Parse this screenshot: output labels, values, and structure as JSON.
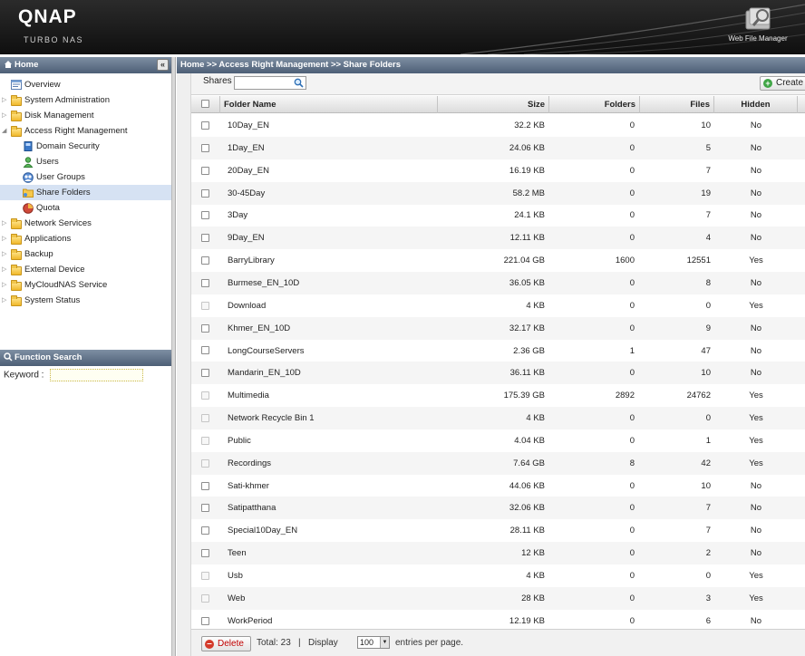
{
  "header": {
    "logo": "QNAP",
    "subtitle": "Turbo NAS",
    "web_file_manager": "Web File Manager"
  },
  "left_panel": {
    "home_label": "Home",
    "tree": [
      {
        "label": "Overview",
        "icon": "overview-icon",
        "level": 0
      },
      {
        "label": "System Administration",
        "icon": "folder-icon",
        "level": 0,
        "arrow": "collapsed"
      },
      {
        "label": "Disk Management",
        "icon": "folder-icon",
        "level": 0,
        "arrow": "collapsed"
      },
      {
        "label": "Access Right Management",
        "icon": "folder-open-icon",
        "level": 0,
        "arrow": "expanded"
      },
      {
        "label": "Domain Security",
        "icon": "domain-security-icon",
        "level": 1
      },
      {
        "label": "Users",
        "icon": "user-icon",
        "level": 1
      },
      {
        "label": "User Groups",
        "icon": "user-groups-icon",
        "level": 1
      },
      {
        "label": "Share Folders",
        "icon": "share-folder-icon",
        "level": 1,
        "selected": true
      },
      {
        "label": "Quota",
        "icon": "quota-icon",
        "level": 1
      },
      {
        "label": "Network Services",
        "icon": "folder-icon",
        "level": 0,
        "arrow": "collapsed"
      },
      {
        "label": "Applications",
        "icon": "folder-icon",
        "level": 0,
        "arrow": "collapsed"
      },
      {
        "label": "Backup",
        "icon": "folder-icon",
        "level": 0,
        "arrow": "collapsed"
      },
      {
        "label": "External Device",
        "icon": "folder-icon",
        "level": 0,
        "arrow": "collapsed"
      },
      {
        "label": "MyCloudNAS Service",
        "icon": "folder-icon",
        "level": 0,
        "arrow": "collapsed"
      },
      {
        "label": "System Status",
        "icon": "folder-icon",
        "level": 0,
        "arrow": "collapsed"
      }
    ],
    "function_search": {
      "title": "Function Search",
      "keyword_label": "Keyword :"
    }
  },
  "breadcrumb": "Home >> Access Right Management >> Share Folders",
  "toolbar": {
    "shares_label": "Shares",
    "create_label": "Create a"
  },
  "table": {
    "columns": [
      "Folder Name",
      "Size",
      "Folders",
      "Files",
      "Hidden"
    ],
    "rows": [
      {
        "name": "10Day_EN",
        "size": "32.2 KB",
        "folders": "0",
        "files": "10",
        "hidden": "No",
        "disabled": false
      },
      {
        "name": "1Day_EN",
        "size": "24.06 KB",
        "folders": "0",
        "files": "5",
        "hidden": "No",
        "disabled": false
      },
      {
        "name": "20Day_EN",
        "size": "16.19 KB",
        "folders": "0",
        "files": "7",
        "hidden": "No",
        "disabled": false
      },
      {
        "name": "30-45Day",
        "size": "58.2 MB",
        "folders": "0",
        "files": "19",
        "hidden": "No",
        "disabled": false
      },
      {
        "name": "3Day",
        "size": "24.1 KB",
        "folders": "0",
        "files": "7",
        "hidden": "No",
        "disabled": false
      },
      {
        "name": "9Day_EN",
        "size": "12.11 KB",
        "folders": "0",
        "files": "4",
        "hidden": "No",
        "disabled": false
      },
      {
        "name": "BarryLibrary",
        "size": "221.04 GB",
        "folders": "1600",
        "files": "12551",
        "hidden": "Yes",
        "disabled": false
      },
      {
        "name": "Burmese_EN_10D",
        "size": "36.05 KB",
        "folders": "0",
        "files": "8",
        "hidden": "No",
        "disabled": false
      },
      {
        "name": "Download",
        "size": "4 KB",
        "folders": "0",
        "files": "0",
        "hidden": "Yes",
        "disabled": true
      },
      {
        "name": "Khmer_EN_10D",
        "size": "32.17 KB",
        "folders": "0",
        "files": "9",
        "hidden": "No",
        "disabled": false
      },
      {
        "name": "LongCourseServers",
        "size": "2.36 GB",
        "folders": "1",
        "files": "47",
        "hidden": "No",
        "disabled": false
      },
      {
        "name": "Mandarin_EN_10D",
        "size": "36.11 KB",
        "folders": "0",
        "files": "10",
        "hidden": "No",
        "disabled": false
      },
      {
        "name": "Multimedia",
        "size": "175.39 GB",
        "folders": "2892",
        "files": "24762",
        "hidden": "Yes",
        "disabled": true
      },
      {
        "name": "Network Recycle Bin 1",
        "size": "4 KB",
        "folders": "0",
        "files": "0",
        "hidden": "Yes",
        "disabled": true
      },
      {
        "name": "Public",
        "size": "4.04 KB",
        "folders": "0",
        "files": "1",
        "hidden": "Yes",
        "disabled": true
      },
      {
        "name": "Recordings",
        "size": "7.64 GB",
        "folders": "8",
        "files": "42",
        "hidden": "Yes",
        "disabled": true
      },
      {
        "name": "Sati-khmer",
        "size": "44.06 KB",
        "folders": "0",
        "files": "10",
        "hidden": "No",
        "disabled": false
      },
      {
        "name": "Satipatthana",
        "size": "32.06 KB",
        "folders": "0",
        "files": "7",
        "hidden": "No",
        "disabled": false
      },
      {
        "name": "Special10Day_EN",
        "size": "28.11 KB",
        "folders": "0",
        "files": "7",
        "hidden": "No",
        "disabled": false
      },
      {
        "name": "Teen",
        "size": "12 KB",
        "folders": "0",
        "files": "2",
        "hidden": "No",
        "disabled": false
      },
      {
        "name": "Usb",
        "size": "4 KB",
        "folders": "0",
        "files": "0",
        "hidden": "Yes",
        "disabled": true
      },
      {
        "name": "Web",
        "size": "28 KB",
        "folders": "0",
        "files": "3",
        "hidden": "Yes",
        "disabled": true
      },
      {
        "name": "WorkPeriod",
        "size": "12.19 KB",
        "folders": "0",
        "files": "6",
        "hidden": "No",
        "disabled": false
      }
    ]
  },
  "footer": {
    "delete_label": "Delete",
    "total_text": "Total: 23",
    "separator": "|",
    "display_label": "Display",
    "page_size": "100",
    "entries_label": "entries per page."
  }
}
